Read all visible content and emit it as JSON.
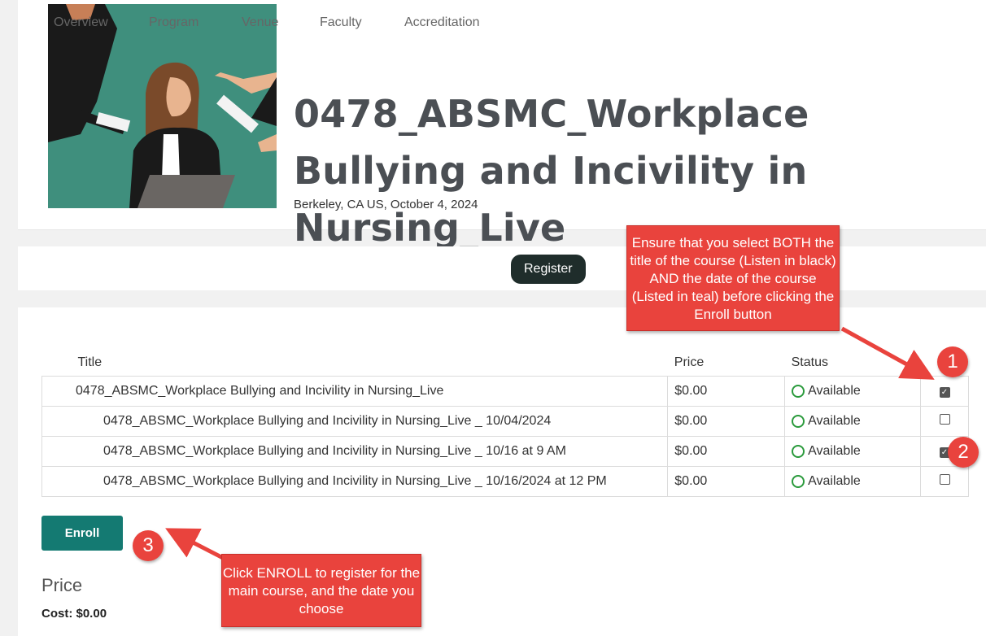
{
  "event": {
    "title": "0478_ABSMC_Workplace Bullying and Incivility in Nursing_Live",
    "location_date": "Berkeley, CA US,  October 4, 2024"
  },
  "tabs": [
    {
      "label": "Overview"
    },
    {
      "label": "Program"
    },
    {
      "label": "Venue"
    },
    {
      "label": "Faculty"
    },
    {
      "label": "Accreditation"
    },
    {
      "label": "Register",
      "active": true
    }
  ],
  "table": {
    "headers": {
      "title": "Title",
      "price": "Price",
      "status": "Status"
    },
    "rows": [
      {
        "title": "0478_ABSMC_Workplace Bullying and Incivility in Nursing_Live",
        "price": "$0.00",
        "status": "Available",
        "checked": true
      },
      {
        "title": "0478_ABSMC_Workplace Bullying and Incivility in Nursing_Live _ 10/04/2024",
        "price": "$0.00",
        "status": "Available",
        "checked": false
      },
      {
        "title": "0478_ABSMC_Workplace Bullying and Incivility in Nursing_Live _ 10/16 at 9 AM",
        "price": "$0.00",
        "status": "Available",
        "checked": true
      },
      {
        "title": "0478_ABSMC_Workplace Bullying and Incivility in Nursing_Live _ 10/16/2024 at 12 PM",
        "price": "$0.00",
        "status": "Available",
        "checked": false
      }
    ]
  },
  "enroll_label": "Enroll",
  "price_section": {
    "heading": "Price",
    "cost": "Cost: $0.00"
  },
  "annotations": {
    "callout_top": "Ensure that you select BOTH the title of the course (Listen in black) AND the date of the course (Listed in teal) before clicking the Enroll button",
    "callout_bottom": "Click ENROLL to register for the main course, and the date you choose",
    "num1": "1",
    "num2": "2",
    "num3": "3"
  },
  "colors": {
    "accent": "#147a72",
    "tab_active": "#1f2d2b",
    "callout": "#e9433d",
    "available": "#2a9a3c"
  }
}
